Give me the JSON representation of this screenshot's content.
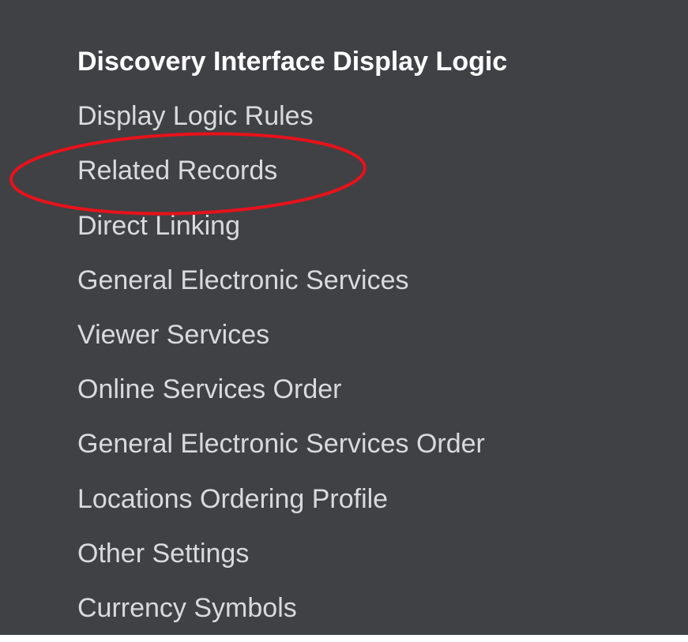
{
  "menu": {
    "title": "Discovery Interface Display Logic",
    "items": [
      {
        "label": "Display Logic Rules"
      },
      {
        "label": "Related Records"
      },
      {
        "label": "Direct Linking"
      },
      {
        "label": "General Electronic Services"
      },
      {
        "label": "Viewer Services"
      },
      {
        "label": "Online Services Order"
      },
      {
        "label": "General Electronic Services Order"
      },
      {
        "label": "Locations Ordering Profile"
      },
      {
        "label": "Other Settings"
      },
      {
        "label": "Currency Symbols"
      }
    ]
  },
  "annotation": {
    "highlighted_item": "Related Records",
    "color": "#e8121b"
  }
}
